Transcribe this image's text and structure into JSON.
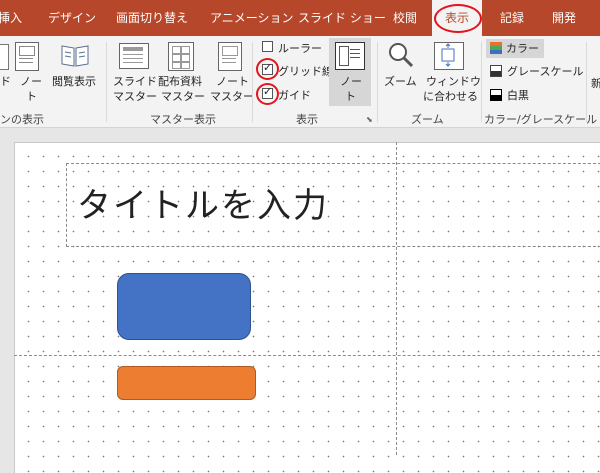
{
  "tabs": [
    {
      "label": "挿入",
      "active": false
    },
    {
      "label": "デザイン",
      "active": false
    },
    {
      "label": "画面切り替え",
      "active": false
    },
    {
      "label": "アニメーション",
      "active": false
    },
    {
      "label": "スライド ショー",
      "active": false
    },
    {
      "label": "校閲",
      "active": false
    },
    {
      "label": "表示",
      "active": true
    },
    {
      "label": "記録",
      "active": false
    },
    {
      "label": "開発",
      "active": false
    }
  ],
  "ribbon": {
    "presentation_views": {
      "partial_label_1": "ド",
      "note_label_1": "ノー",
      "note_label_2": "ト",
      "reading_view_label": "閲覧表示",
      "group_label": "ンの表示"
    },
    "master_views": {
      "slide_master_label_1": "スライド",
      "slide_master_label_2": "マスター",
      "handout_master_label_1": "配布資料",
      "handout_master_label_2": "マスター",
      "notes_master_label_1": "ノート",
      "notes_master_label_2": "マスター",
      "group_label": "マスター表示"
    },
    "show": {
      "ruler_label": "ルーラー",
      "ruler_checked": false,
      "gridlines_label": "グリッド線",
      "gridlines_checked": true,
      "guides_label": "ガイド",
      "guides_checked": true,
      "notes_label_1": "ノー",
      "notes_label_2": "ト",
      "group_label": "表示"
    },
    "zoom": {
      "zoom_label": "ズーム",
      "fit_window_label_1": "ウィンドウ",
      "fit_window_label_2": "に合わせる",
      "group_label": "ズーム"
    },
    "color": {
      "color_label": "カラー",
      "grayscale_label": "グレースケール",
      "bw_label": "白黒",
      "group_label": "カラー/グレースケール"
    },
    "partial_right_label": "新"
  },
  "slide": {
    "title_placeholder": "タイトルを入力",
    "shape_colors": {
      "blue": "#4472c4",
      "orange": "#ed7d31"
    }
  },
  "colors": {
    "accent": "#b7472a",
    "highlight_ring": "#e3141e"
  }
}
